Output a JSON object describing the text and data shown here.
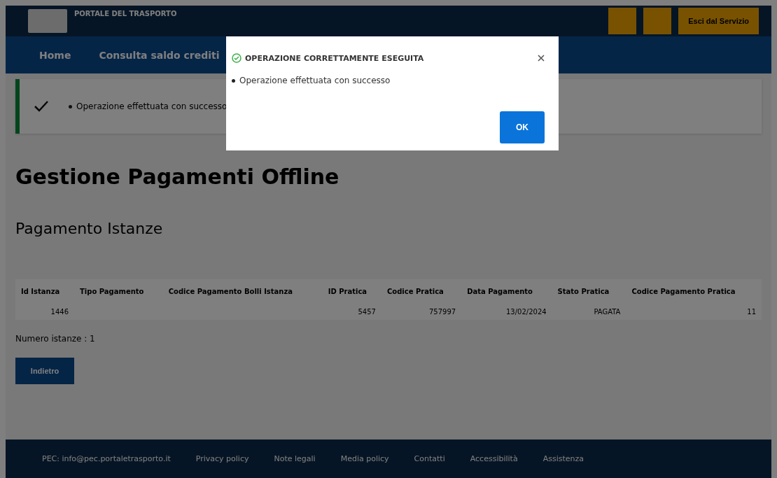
{
  "header": {
    "title": "PORTALE DEL TRASPORTO",
    "buttons": [
      {
        "kind": "icon"
      },
      {
        "kind": "icon"
      },
      {
        "kind": "text",
        "label": "Esci dal Servizio"
      }
    ]
  },
  "nav": {
    "items": [
      {
        "label": "Home",
        "selected": false
      },
      {
        "label": "Consulta saldo crediti",
        "selected": false
      }
    ]
  },
  "alert": {
    "items": [
      "Operazione effettuata con successo"
    ]
  },
  "page_title": "Gestione Pagamenti Offline",
  "section_title": "Pagamento Istanze",
  "table": {
    "columns": [
      "Id Istanza",
      "Tipo Pagamento",
      "Codice Pagamento Bolli Istanza",
      "ID Pratica",
      "Codice Pratica",
      "Data Pagamento",
      "Stato Pratica",
      "Codice Pagamento Pratica"
    ],
    "rows": [
      [
        "1446",
        "",
        "",
        "5457",
        "757997",
        "13/02/2024",
        "PAGATA",
        "11"
      ]
    ]
  },
  "count": "Numero istanze : 1",
  "back_button": "Indietro",
  "footer": {
    "links": [
      "PEC: info@pec.portaletrasporto.it",
      "Privacy policy",
      "Note legali",
      "Media policy",
      "Contatti",
      "Accessibilità",
      "Assistenza"
    ]
  },
  "modal": {
    "title": "OPERAZIONE CORRETTAMENTE ESEGUITA",
    "messages": [
      "Operazione effettuata con successo"
    ],
    "ok": "OK"
  }
}
